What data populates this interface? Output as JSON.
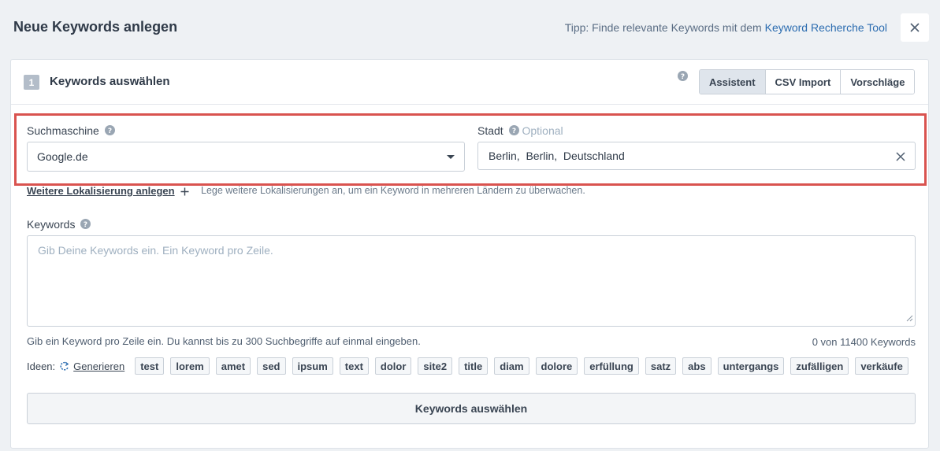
{
  "modal": {
    "title": "Neue Keywords anlegen",
    "tip_prefix": "Tipp: Finde relevante Keywords mit dem",
    "tip_link": "Keyword Recherche Tool",
    "close_icon": "close-icon"
  },
  "step": {
    "number": "1",
    "title": "Keywords auswählen",
    "tabs": [
      "Assistent",
      "CSV Import",
      "Vorschläge"
    ],
    "active_tab": "Assistent"
  },
  "location": {
    "engine_label": "Suchmaschine",
    "engine_value": "Google.de",
    "city_label": "Stadt",
    "city_optional": "Optional",
    "city_value": "Berlin,  Berlin,  Deutschland",
    "more_link": "Weitere Lokalisierung anlegen",
    "more_hint": "Lege weitere Lokalisierungen an, um ein Keyword in mehreren Ländern zu überwachen.",
    "highlight_color": "#d9534f"
  },
  "keywords": {
    "label": "Keywords",
    "placeholder": "Gib Deine Keywords ein. Ein Keyword pro Zeile.",
    "hint": "Gib ein Keyword pro Zeile ein. Du kannst bis zu 300 Suchbegriffe auf einmal eingeben.",
    "count": "0 von 11400 Keywords"
  },
  "ideas": {
    "label": "Ideen:",
    "generate": "Generieren",
    "chips": [
      "test",
      "lorem",
      "amet",
      "sed",
      "ipsum",
      "text",
      "dolor",
      "site2",
      "title",
      "diam",
      "dolore",
      "erfüllung",
      "satz",
      "abs",
      "untergangs",
      "zufälligen",
      "verkäufe"
    ]
  },
  "submit": {
    "label": "Keywords auswählen"
  }
}
